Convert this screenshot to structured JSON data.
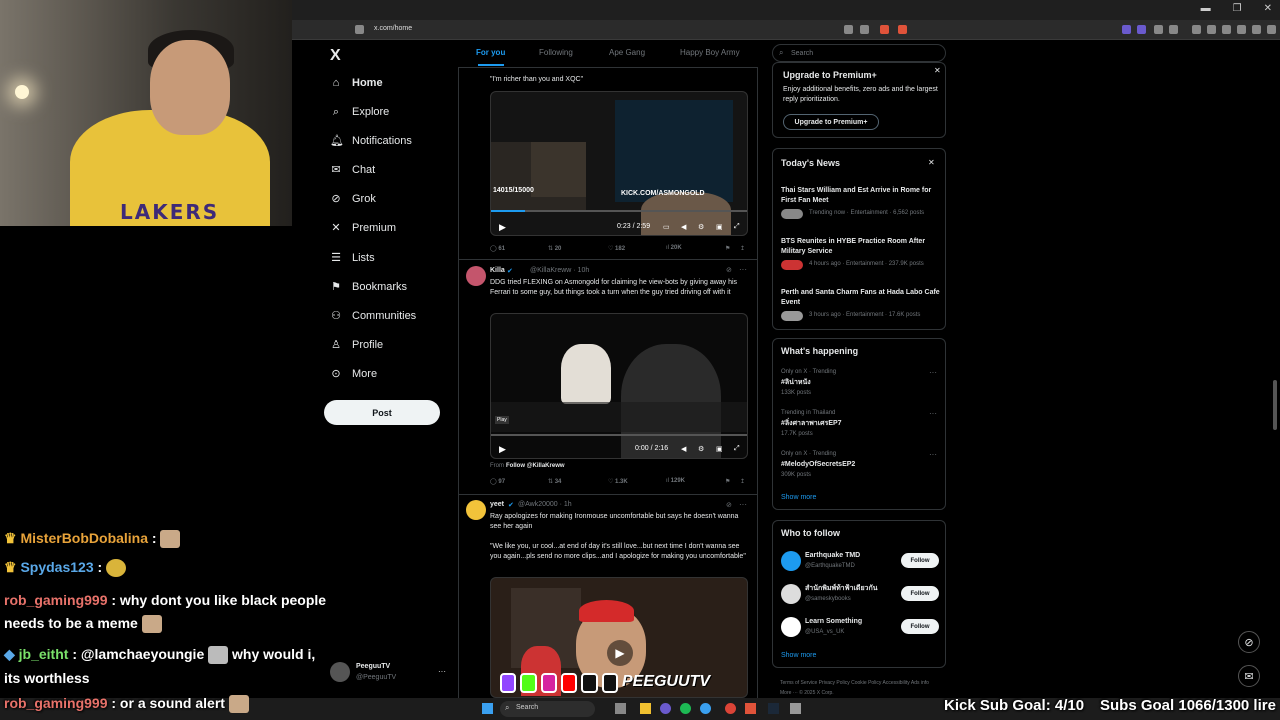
{
  "browser": {
    "url": "x.com/home"
  },
  "nav": {
    "logo": "X",
    "items": [
      {
        "label": "Home",
        "icon": "home-icon"
      },
      {
        "label": "Explore",
        "icon": "search-icon"
      },
      {
        "label": "Notifications",
        "icon": "bell-icon"
      },
      {
        "label": "Chat",
        "icon": "mail-icon"
      },
      {
        "label": "Grok",
        "icon": "grok-icon"
      },
      {
        "label": "Premium",
        "icon": "x-icon"
      },
      {
        "label": "Lists",
        "icon": "list-icon"
      },
      {
        "label": "Bookmarks",
        "icon": "bookmark-icon"
      },
      {
        "label": "Communities",
        "icon": "people-icon"
      },
      {
        "label": "Profile",
        "icon": "user-icon"
      },
      {
        "label": "More",
        "icon": "more-icon"
      }
    ],
    "post_label": "Post",
    "user": {
      "name": "PeeguuTV",
      "handle": "@PeeguuTV"
    }
  },
  "feed": {
    "tabs": [
      "For you",
      "Following",
      "Ape Gang",
      "Happy Boy Army"
    ],
    "tweet1": {
      "text": "\"I'm richer than you and XQC\"",
      "overlay_count": "14015/15000",
      "overlay_kick": "KICK.COM/ASMONGOLD",
      "time": "0:23 / 2:59",
      "replies": "61",
      "reposts": "20",
      "likes": "182",
      "views": "20K"
    },
    "tweet2": {
      "name": "Killa",
      "handle": "@KillaKreww · 10h",
      "text": "DDG tried FLEXING on Asmongold for claiming he view-bots by giving away his Ferrari to some guy, but things took a turn when the guy tried driving off with it",
      "time": "0:00 / 2:16",
      "play": "Play",
      "follow_note": "From",
      "follow_link": "Follow @KillaKreww",
      "replies": "97",
      "reposts": "34",
      "likes": "1.3K",
      "views": "129K"
    },
    "tweet3": {
      "name": "yeet",
      "handle": "@Awk20000 · 1h",
      "text": "Ray apologizes for making Ironmouse uncomfortable but says he doesn't wanna see her again",
      "quote": "\"We like you, ur cool...at end of day it's still love...but next time I don't wanna see you again...pls send no more clips...and I apologize for making you uncomfortable\""
    }
  },
  "right": {
    "search_placeholder": "Search",
    "premium": {
      "title": "Upgrade to Premium+",
      "body": "Enjoy additional benefits, zero ads and the largest reply prioritization.",
      "button": "Upgrade to Premium+"
    },
    "news": {
      "title": "Today's News",
      "items": [
        {
          "headline": "Thai Stars William and Est Arrive in Rome for First Fan Meet",
          "meta": "Trending now · Entertainment · 6,562 posts"
        },
        {
          "headline": "BTS Reunites in HYBE Practice Room After Military Service",
          "meta": "4 hours ago · Entertainment · 237.9K posts"
        },
        {
          "headline": "Perth and Santa Charm Fans at Hada Labo Cafe Event",
          "meta": "3 hours ago · Entertainment · 17.6K posts"
        }
      ]
    },
    "happening": {
      "title": "What's happening",
      "items": [
        {
          "context": "Only on X · Trending",
          "tag": "#ลิน่าหนัง",
          "posts": "133K posts"
        },
        {
          "context": "Trending in Thailand",
          "tag": "#ลิ่งศาลาพาเศรEP7",
          "posts": "17.7K posts"
        },
        {
          "context": "Only on X · Trending",
          "tag": "#MelodyOfSecretsEP2",
          "posts": "309K posts"
        }
      ],
      "show_more": "Show more"
    },
    "who": {
      "title": "Who to follow",
      "items": [
        {
          "name": "Earthquake TMD",
          "handle": "@EarthquakeTMD",
          "button": "Follow"
        },
        {
          "name": "สำนักพิมพ์ท้าฟ้าเดียวกัน",
          "handle": "@sameskybooks",
          "button": "Follow"
        },
        {
          "name": "Learn Something",
          "handle": "@USA_vs_UK",
          "button": "Follow"
        }
      ],
      "show_more": "Show more"
    },
    "footer": "Terms of Service   Privacy Policy   Cookie Policy   Accessibility   Ads info   More ···   © 2025 X Corp."
  },
  "chat": [
    {
      "user": "MisterBobDobalina",
      "text": ":"
    },
    {
      "user": "Spydas123",
      "text": ":"
    },
    {
      "user": "rob_gaming999",
      "text": ": why dont you like black people needs to be a meme"
    },
    {
      "user": "jb_eitht",
      "text": ": @lamchaeyoungie",
      "text2": "why would i, its worthless"
    },
    {
      "user": "rob_gaming999",
      "text": ": or a sound alert"
    }
  ],
  "overlay": {
    "kick_goal": "Kick Sub Goal: 4/10",
    "subs_goal": "Subs Goal 1066/1300 lire",
    "brand": "PEEGUUTV",
    "taskbar_search": "Search"
  }
}
